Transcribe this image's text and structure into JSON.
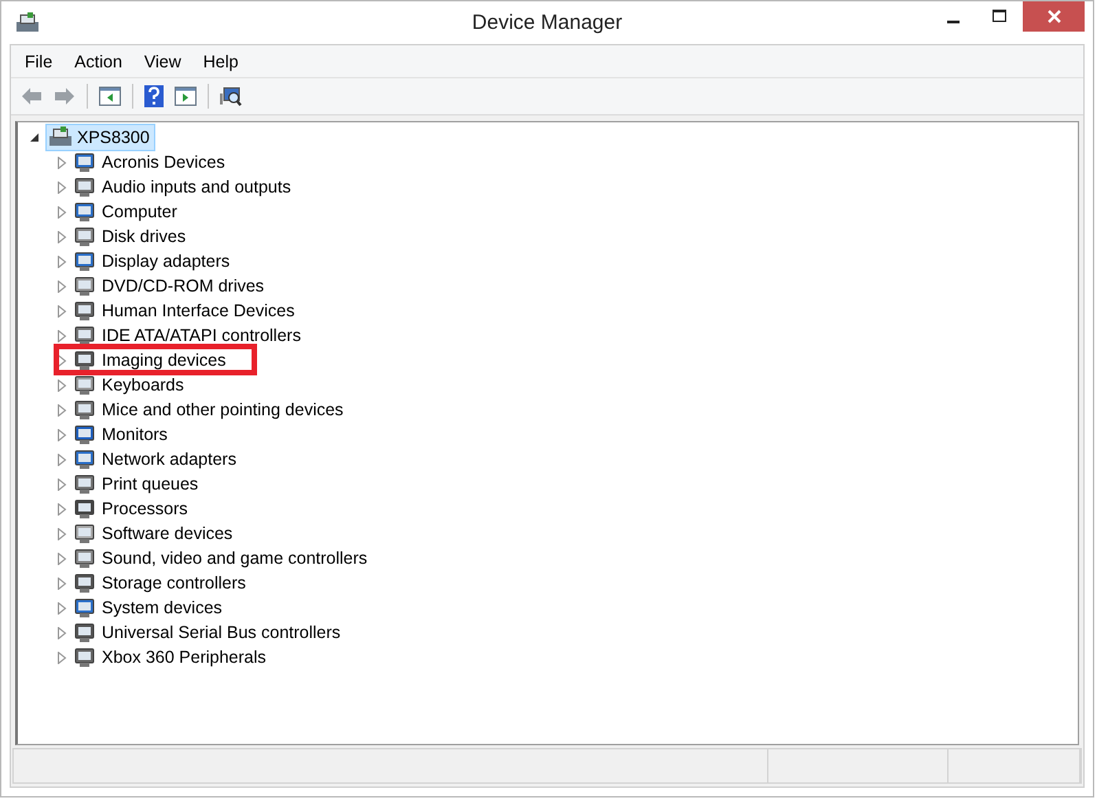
{
  "window": {
    "title": "Device Manager"
  },
  "menu": [
    "File",
    "Action",
    "View",
    "Help"
  ],
  "tree": {
    "label": "XPS8300",
    "expanded": true,
    "selected": true,
    "children": [
      {
        "label": "Acronis Devices",
        "expanded": false,
        "highlighted": false
      },
      {
        "label": "Audio inputs and outputs",
        "expanded": false,
        "highlighted": false
      },
      {
        "label": "Computer",
        "expanded": false,
        "highlighted": false
      },
      {
        "label": "Disk drives",
        "expanded": false,
        "highlighted": false
      },
      {
        "label": "Display adapters",
        "expanded": false,
        "highlighted": false
      },
      {
        "label": "DVD/CD-ROM drives",
        "expanded": false,
        "highlighted": false
      },
      {
        "label": "Human Interface Devices",
        "expanded": false,
        "highlighted": false
      },
      {
        "label": "IDE ATA/ATAPI controllers",
        "expanded": false,
        "highlighted": false
      },
      {
        "label": "Imaging devices",
        "expanded": false,
        "highlighted": true
      },
      {
        "label": "Keyboards",
        "expanded": false,
        "highlighted": false
      },
      {
        "label": "Mice and other pointing devices",
        "expanded": false,
        "highlighted": false
      },
      {
        "label": "Monitors",
        "expanded": false,
        "highlighted": false
      },
      {
        "label": "Network adapters",
        "expanded": false,
        "highlighted": false
      },
      {
        "label": "Print queues",
        "expanded": false,
        "highlighted": false
      },
      {
        "label": "Processors",
        "expanded": false,
        "highlighted": false
      },
      {
        "label": "Software devices",
        "expanded": false,
        "highlighted": false
      },
      {
        "label": "Sound, video and game controllers",
        "expanded": false,
        "highlighted": false
      },
      {
        "label": "Storage controllers",
        "expanded": false,
        "highlighted": false
      },
      {
        "label": "System devices",
        "expanded": false,
        "highlighted": false
      },
      {
        "label": "Universal Serial Bus controllers",
        "expanded": false,
        "highlighted": false
      },
      {
        "label": "Xbox 360 Peripherals",
        "expanded": false,
        "highlighted": false
      }
    ]
  }
}
